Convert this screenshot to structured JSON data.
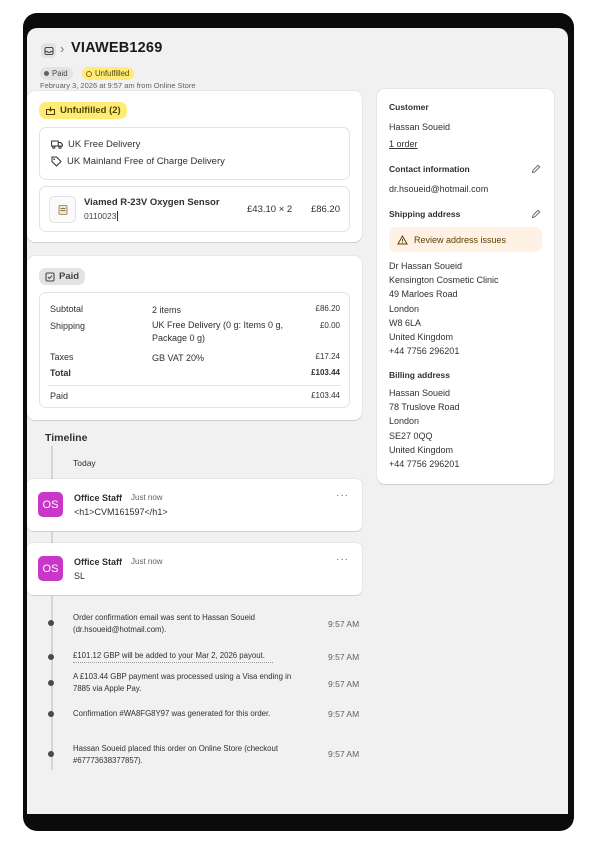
{
  "order": {
    "title": "VIAWEB1269",
    "paid_badge": "Paid",
    "fulfillment_badge": "Unfulfilled",
    "date_line": "February 3, 2026 at 9:57 am from Online Store"
  },
  "unfulfilled": {
    "badge": "Unfulfilled (2)",
    "shipping_method": "UK Free Delivery",
    "shipping_rate": "UK Mainland Free of Charge Delivery",
    "item": {
      "name": "Viamed R-23V Oxygen Sensor",
      "sku": "0110023",
      "unit_price_qty": "£43.10 × 2",
      "total": "£86.20"
    }
  },
  "payment": {
    "badge": "Paid",
    "rows": [
      {
        "label": "Subtotal",
        "middle": "2 items",
        "value": "£86.20"
      },
      {
        "label": "Shipping",
        "middle": "UK Free Delivery (0 g: Items 0 g, Package 0 g)",
        "value": "£0.00"
      },
      {
        "label": "Taxes",
        "middle": "GB VAT 20%",
        "value": "£17.24"
      },
      {
        "label": "Total",
        "middle": "",
        "value": "£103.44"
      },
      {
        "label": "Paid",
        "middle": "",
        "value": "£103.44"
      }
    ]
  },
  "timeline": {
    "title": "Timeline",
    "today_label": "Today",
    "comments": [
      {
        "initials": "OS",
        "author": "Office Staff",
        "time": "Just now",
        "text": "<h1>CVM161597</h1>",
        "menu": "···"
      },
      {
        "initials": "OS",
        "author": "Office Staff",
        "time": "Just now",
        "text": "SL",
        "menu": "···"
      }
    ],
    "events": [
      {
        "text": "Order confirmation email was sent to Hassan Soueid (dr.hsoueid@hotmail.com).",
        "time": "9:57 AM"
      },
      {
        "text": "£101.12 GBP will be added to your Mar 2, 2026 payout.",
        "time": "9:57 AM"
      },
      {
        "text": "A £103.44 GBP payment was processed using a Visa ending in 7885 via Apple Pay.",
        "time": "9:57 AM"
      },
      {
        "text": "Confirmation #WA8FG8Y97 was generated for this order.",
        "time": "9:57 AM"
      },
      {
        "text": "Hassan Soueid placed this order on Online Store (checkout #67773638377857).",
        "time": "9:57 AM"
      }
    ]
  },
  "customer": {
    "heading": "Customer",
    "name": "Hassan Soueid",
    "orders": "1 order",
    "contact_heading": "Contact information",
    "email": "dr.hsoueid@hotmail.com",
    "shipping_heading": "Shipping address",
    "warning": "Review address issues",
    "shipping_address": [
      "Dr Hassan Soueid",
      "Kensington Cosmetic Clinic",
      "49 Marloes Road",
      "London",
      "W8 6LA",
      "United Kingdom",
      "+44 7756 296201"
    ],
    "billing_heading": "Billing address",
    "billing_address": [
      "Hassan Soueid",
      "78 Truslove Road",
      "London",
      "SE27 0QQ",
      "United Kingdom",
      "+44 7756 296201"
    ]
  },
  "colors": {
    "unfulfilled_badge": "#ffeb78",
    "avatar": "#c837c8",
    "warning_bg": "#fff1e3"
  },
  "icons": [
    "inbox-icon",
    "truck-icon",
    "tag-icon",
    "unfulfilled-box-icon",
    "paid-check-icon",
    "product-thumbnail-icon",
    "pencil-icon",
    "warning-icon"
  ]
}
